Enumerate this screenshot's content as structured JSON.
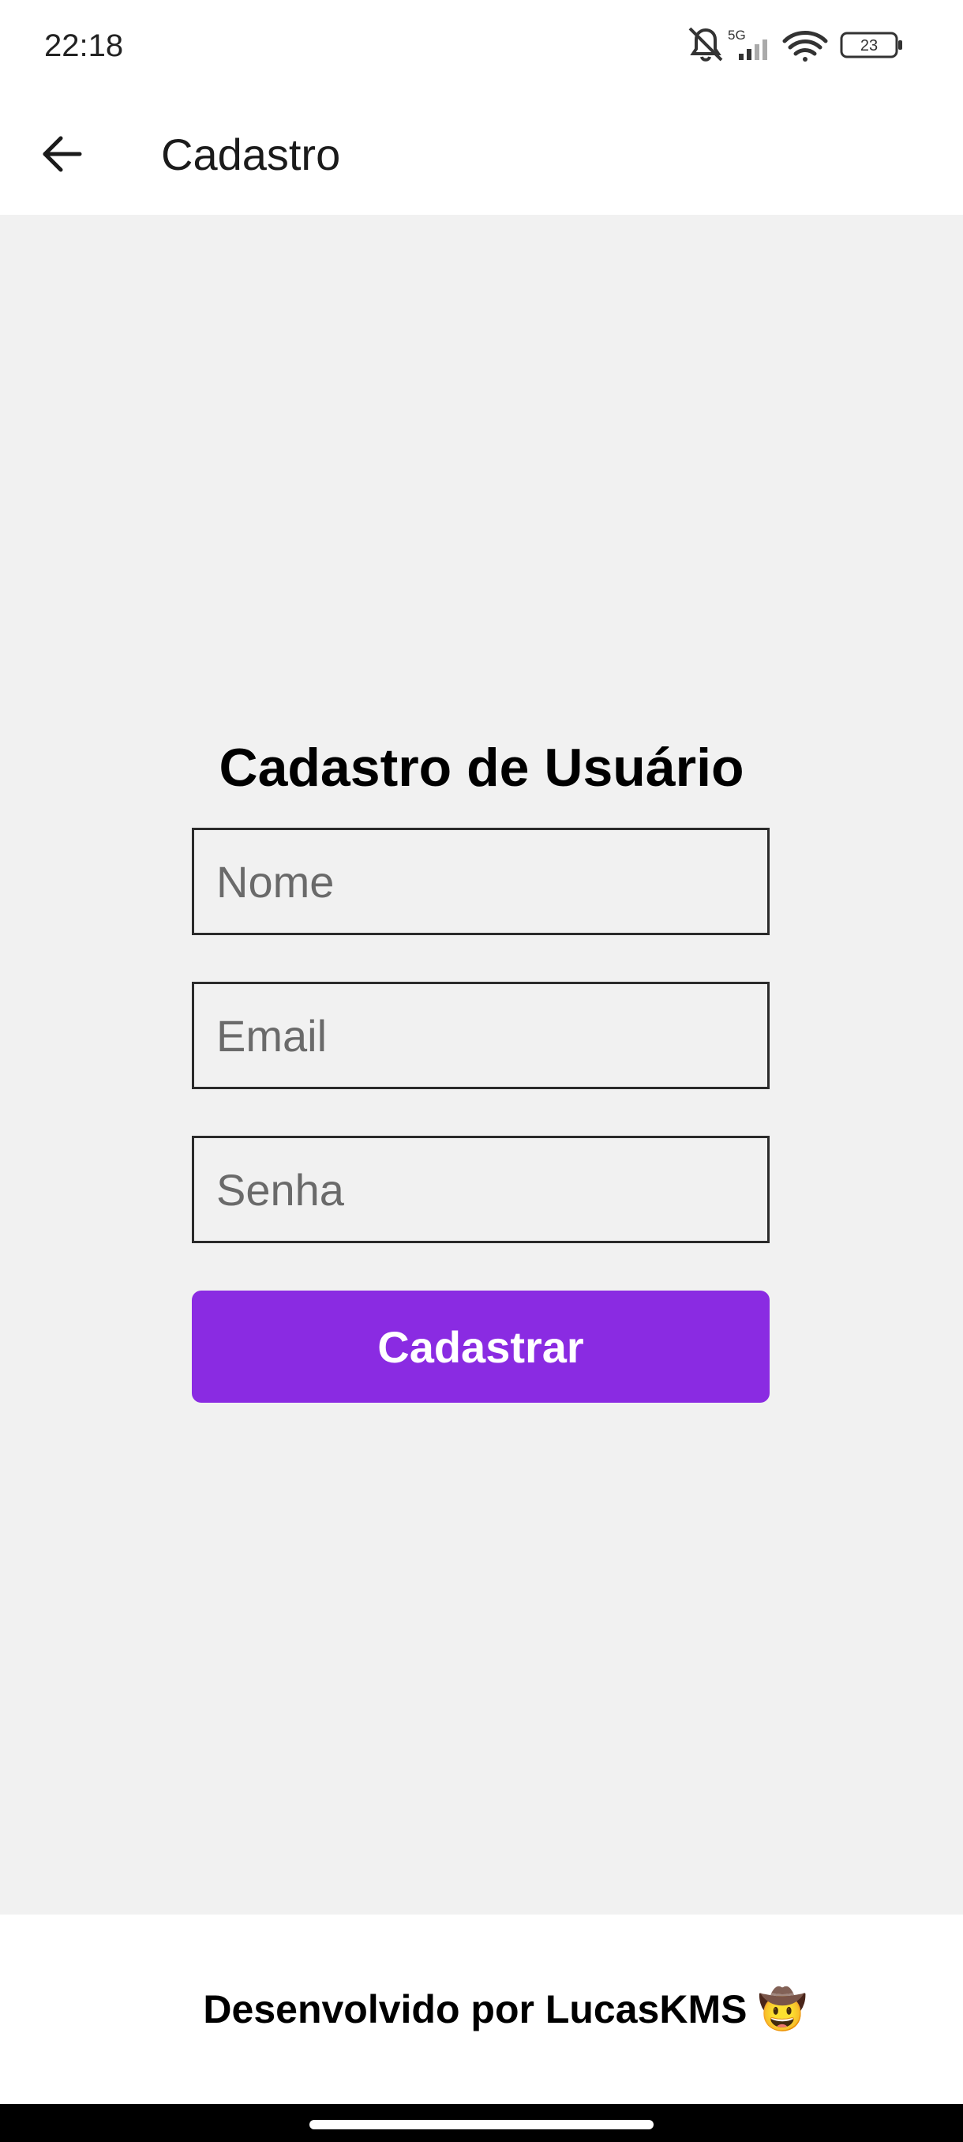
{
  "status_bar": {
    "time": "22:18",
    "network": "5G",
    "battery": "23",
    "icons": [
      "bell-muted-icon",
      "signal-icon",
      "wifi-icon",
      "battery-icon"
    ]
  },
  "app_bar": {
    "back_icon": "arrow-left-icon",
    "title": "Cadastro"
  },
  "form": {
    "title": "Cadastro de Usuário",
    "fields": [
      {
        "placeholder": "Nome",
        "value": ""
      },
      {
        "placeholder": "Email",
        "value": ""
      },
      {
        "placeholder": "Senha",
        "value": ""
      }
    ],
    "submit_label": "Cadastrar"
  },
  "footer": {
    "text": "Desenvolvido por LucasKMS 🤠"
  },
  "colors": {
    "accent": "#8a2be2",
    "background": "#f1f1f1",
    "surface": "#ffffff"
  }
}
